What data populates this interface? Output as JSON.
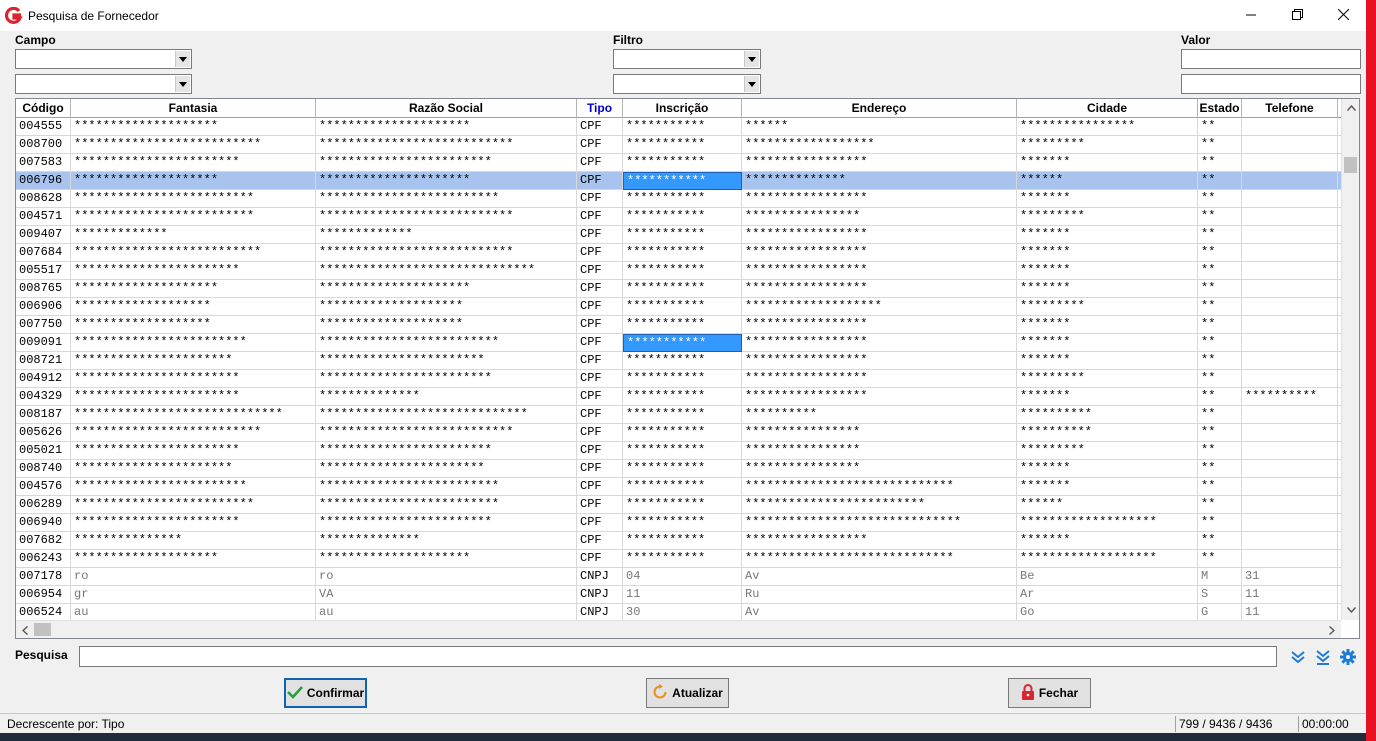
{
  "window": {
    "title": "Pesquisa de Fornecedor",
    "logo_icon": "g-logo-icon",
    "controls": [
      "minimize-icon",
      "restore-icon",
      "close-icon"
    ]
  },
  "filters": {
    "campo_label": "Campo",
    "filtro_label": "Filtro",
    "valor_label": "Valor",
    "campo_1": "",
    "campo_2": "",
    "filtro_1": "",
    "filtro_2": "",
    "valor_1": "",
    "valor_2": ""
  },
  "grid": {
    "columns": [
      "Código",
      "Fantasia",
      "Razão Social",
      "Tipo",
      "Inscrição",
      "Endereço",
      "Cidade",
      "Estado",
      "Telefone"
    ],
    "selected_row": 3,
    "active_cell_rows": [
      3,
      12
    ],
    "rows": [
      [
        "004555",
        "********************",
        "*********************",
        "CPF",
        "***********",
        "******",
        "****************",
        "**",
        ""
      ],
      [
        "008700",
        "**************************",
        "***************************",
        "CPF",
        "***********",
        "******************",
        "*********",
        "**",
        ""
      ],
      [
        "007583",
        "***********************",
        "************************",
        "CPF",
        "***********",
        "*****************",
        "*******",
        "**",
        ""
      ],
      [
        "006796",
        "********************",
        "*********************",
        "CPF",
        "***********",
        "**************",
        "******",
        "**",
        ""
      ],
      [
        "008628",
        "*************************",
        "*************************",
        "CPF",
        "***********",
        "*****************",
        "*******",
        "**",
        ""
      ],
      [
        "004571",
        "*************************",
        "***************************",
        "CPF",
        "***********",
        "****************",
        "*********",
        "**",
        ""
      ],
      [
        "009407",
        "*************",
        "*************",
        "CPF",
        "***********",
        "*****************",
        "*******",
        "**",
        ""
      ],
      [
        "007684",
        "**************************",
        "***************************",
        "CPF",
        "***********",
        "*****************",
        "*******",
        "**",
        ""
      ],
      [
        "005517",
        "***********************",
        "******************************",
        "CPF",
        "***********",
        "*****************",
        "*******",
        "**",
        ""
      ],
      [
        "008765",
        "********************",
        "*********************",
        "CPF",
        "***********",
        "*****************",
        "*******",
        "**",
        ""
      ],
      [
        "006906",
        "*******************",
        "********************",
        "CPF",
        "***********",
        "*******************",
        "*********",
        "**",
        ""
      ],
      [
        "007750",
        "*******************",
        "********************",
        "CPF",
        "***********",
        "*****************",
        "*******",
        "**",
        ""
      ],
      [
        "009091",
        "************************",
        "*************************",
        "CPF",
        "***********",
        "*****************",
        "*******",
        "**",
        ""
      ],
      [
        "008721",
        "**********************",
        "***********************",
        "CPF",
        "***********",
        "*****************",
        "*******",
        "**",
        ""
      ],
      [
        "004912",
        "***********************",
        "************************",
        "CPF",
        "***********",
        "*****************",
        "*********",
        "**",
        ""
      ],
      [
        "004329",
        "***********************",
        "**************",
        "CPF",
        "***********",
        "*****************",
        "*******",
        "**",
        "**********"
      ],
      [
        "008187",
        "*****************************",
        "*****************************",
        "CPF",
        "***********",
        "**********",
        "**********",
        "**",
        ""
      ],
      [
        "005626",
        "**************************",
        "***************************",
        "CPF",
        "***********",
        "****************",
        "**********",
        "**",
        ""
      ],
      [
        "005021",
        "***********************",
        "************************",
        "CPF",
        "***********",
        "****************",
        "*********",
        "**",
        ""
      ],
      [
        "008740",
        "**********************",
        "***********************",
        "CPF",
        "***********",
        "****************",
        "*******",
        "**",
        ""
      ],
      [
        "004576",
        "************************",
        "*************************",
        "CPF",
        "***********",
        "*****************************",
        "*******",
        "**",
        ""
      ],
      [
        "006289",
        "*************************",
        "*************************",
        "CPF",
        "***********",
        "*************************",
        "******",
        "**",
        ""
      ],
      [
        "006940",
        "***********************",
        "************************",
        "CPF",
        "***********",
        "******************************",
        "*******************",
        "**",
        ""
      ],
      [
        "007682",
        "***************",
        "**************",
        "CPF",
        "***********",
        "*****************",
        "*******",
        "**",
        ""
      ],
      [
        "006243",
        "********************",
        "*********************",
        "CPF",
        "***********",
        "*****************************",
        "*******************",
        "**",
        ""
      ],
      [
        "007178",
        "ro",
        "ro",
        "CNPJ",
        "04",
        "Av",
        "Be",
        "M",
        "31"
      ],
      [
        "006954",
        "gr",
        "VA",
        "CNPJ",
        "11",
        "Ru",
        "Ar",
        "S",
        "11"
      ],
      [
        "006524",
        "au",
        "au",
        "CNPJ",
        "30",
        "Av",
        "Go",
        "G",
        "11"
      ]
    ]
  },
  "search": {
    "label": "Pesquisa",
    "value": "",
    "icons": [
      "double-chevron-down-icon",
      "jump-to-end-icon",
      "gear-icon"
    ]
  },
  "buttons": {
    "confirm": "Confirmar",
    "refresh": "Atualizar",
    "close": "Fechar"
  },
  "status": {
    "sort_text": "Decrescente por: Tipo",
    "counter": "799 / 9436 / 9436",
    "time": "00:00:00"
  },
  "colors": {
    "selected_row": "#a8c4ee",
    "active_cell": "#3399ff",
    "tipo_header": "#0000cc",
    "accent": "#1b7bd6",
    "brand_red": "#d9252f"
  }
}
